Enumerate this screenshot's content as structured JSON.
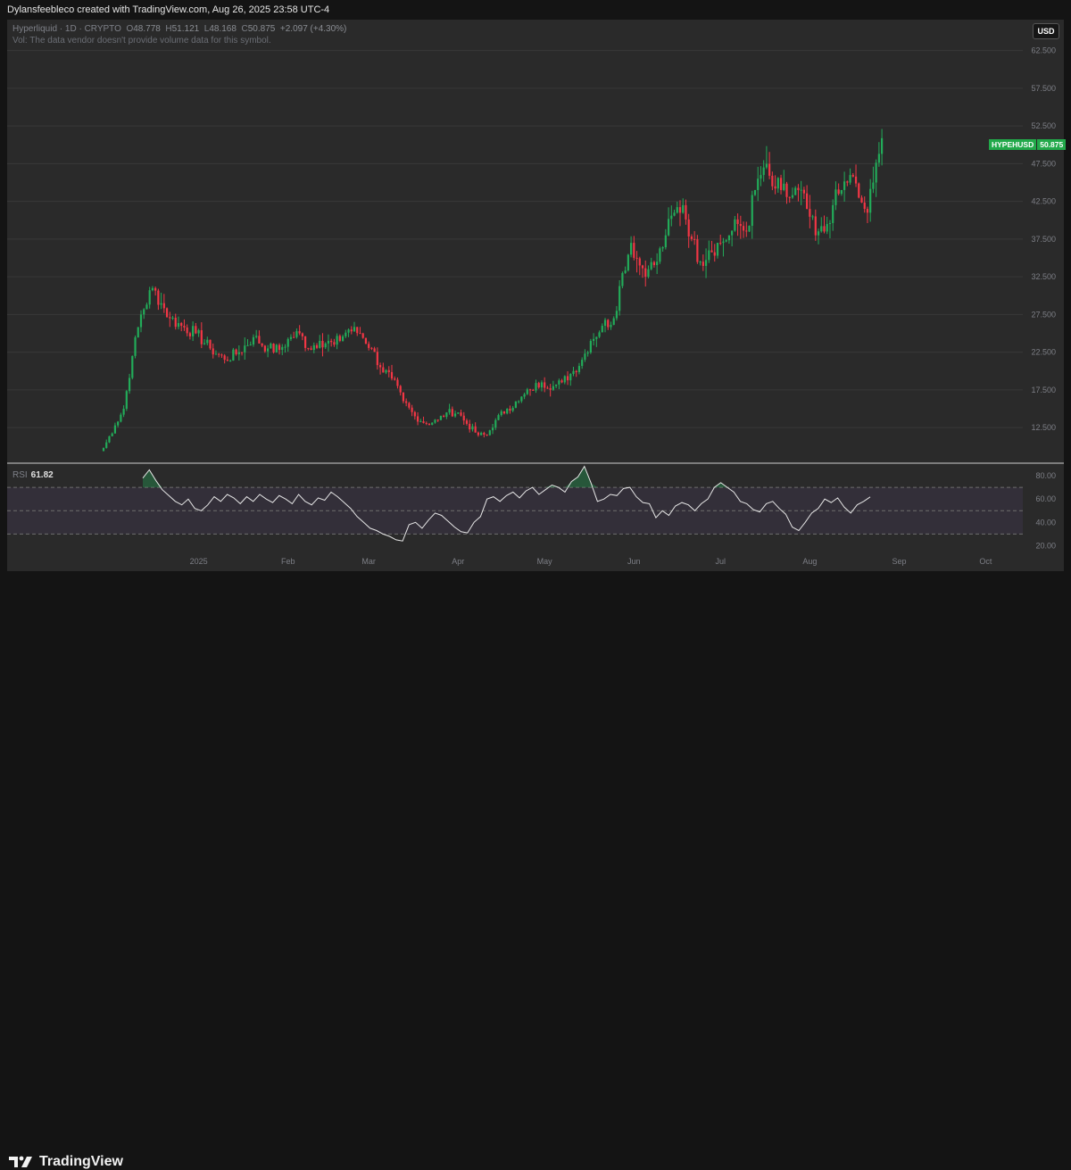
{
  "header": {
    "credit": "Dylansfeebleco created with TradingView.com, Aug 26, 2025 23:58 UTC-4"
  },
  "symbol_info": {
    "name": "Hyperliquid · 1D · CRYPTO",
    "open_label": "O",
    "open": "48.778",
    "high_label": "H",
    "high": "51.121",
    "low_label": "L",
    "low": "48.168",
    "close_label": "C",
    "close": "50.875",
    "change": "+2.097 (+4.30%)",
    "vol_note": "Vol: The data vendor doesn't provide volume data for this symbol."
  },
  "currency_button": "USD",
  "ticker": {
    "symbol": "HYPEHUSD",
    "price": "50.875"
  },
  "rsi": {
    "label": "RSI",
    "value": "61.82"
  },
  "footer": {
    "brand": "TradingView"
  },
  "colors": {
    "up": "#22ab59",
    "down": "#f23645",
    "background": "#2a2a2a",
    "rsi_line": "#e6e6e6",
    "rsi_band": "#3a3346"
  },
  "chart_data": [
    {
      "type": "candlestick",
      "title": "Hyperliquid · 1D · CRYPTO",
      "y_axis_ticks": [
        "62.500",
        "57.500",
        "52.500",
        "47.500",
        "42.500",
        "37.500",
        "32.500",
        "27.500",
        "22.500",
        "17.500",
        "12.500"
      ],
      "x_axis_ticks": [
        "2025",
        "Feb",
        "Mar",
        "Apr",
        "May",
        "Jun",
        "Jul",
        "Aug",
        "Sep",
        "Oct"
      ],
      "ylim": [
        7.9,
        66.6
      ],
      "x_start": "2024-11-29",
      "close_series": [
        {
          "date": "2024-11-29",
          "close": 9.8
        },
        {
          "date": "2024-12-03",
          "close": 12.8
        },
        {
          "date": "2024-12-06",
          "close": 15.0
        },
        {
          "date": "2024-12-09",
          "close": 22.0
        },
        {
          "date": "2024-12-12",
          "close": 27.5
        },
        {
          "date": "2024-12-16",
          "close": 31.0
        },
        {
          "date": "2024-12-19",
          "close": 29.0
        },
        {
          "date": "2024-12-22",
          "close": 27.0
        },
        {
          "date": "2024-12-26",
          "close": 26.0
        },
        {
          "date": "2024-12-31",
          "close": 25.0
        },
        {
          "date": "2025-01-05",
          "close": 23.0
        },
        {
          "date": "2025-01-10",
          "close": 21.5
        },
        {
          "date": "2025-01-15",
          "close": 22.5
        },
        {
          "date": "2025-01-20",
          "close": 24.5
        },
        {
          "date": "2025-01-25",
          "close": 23.0
        },
        {
          "date": "2025-01-29",
          "close": 22.8
        },
        {
          "date": "2025-02-02",
          "close": 24.5
        },
        {
          "date": "2025-02-05",
          "close": 25.0
        },
        {
          "date": "2025-02-08",
          "close": 23.0
        },
        {
          "date": "2025-02-12",
          "close": 24.0
        },
        {
          "date": "2025-02-17",
          "close": 23.5
        },
        {
          "date": "2025-02-22",
          "close": 25.5
        },
        {
          "date": "2025-02-26",
          "close": 25.0
        },
        {
          "date": "2025-03-02",
          "close": 23.0
        },
        {
          "date": "2025-03-05",
          "close": 20.5
        },
        {
          "date": "2025-03-09",
          "close": 19.0
        },
        {
          "date": "2025-03-13",
          "close": 16.0
        },
        {
          "date": "2025-03-17",
          "close": 14.0
        },
        {
          "date": "2025-03-21",
          "close": 13.0
        },
        {
          "date": "2025-03-25",
          "close": 13.5
        },
        {
          "date": "2025-03-28",
          "close": 14.5
        },
        {
          "date": "2025-04-01",
          "close": 14.5
        },
        {
          "date": "2025-04-04",
          "close": 13.0
        },
        {
          "date": "2025-04-08",
          "close": 11.5
        },
        {
          "date": "2025-04-11",
          "close": 11.5
        },
        {
          "date": "2025-04-14",
          "close": 13.5
        },
        {
          "date": "2025-04-18",
          "close": 15.0
        },
        {
          "date": "2025-04-22",
          "close": 16.0
        },
        {
          "date": "2025-04-26",
          "close": 17.5
        },
        {
          "date": "2025-04-30",
          "close": 18.5
        },
        {
          "date": "2025-05-04",
          "close": 18.0
        },
        {
          "date": "2025-05-07",
          "close": 18.5
        },
        {
          "date": "2025-05-11",
          "close": 20.0
        },
        {
          "date": "2025-05-14",
          "close": 21.5
        },
        {
          "date": "2025-05-17",
          "close": 24.0
        },
        {
          "date": "2025-05-21",
          "close": 26.0
        },
        {
          "date": "2025-05-25",
          "close": 27.0
        },
        {
          "date": "2025-05-28",
          "close": 33.0
        },
        {
          "date": "2025-05-31",
          "close": 37.0
        },
        {
          "date": "2025-06-03",
          "close": 34.0
        },
        {
          "date": "2025-06-06",
          "close": 33.5
        },
        {
          "date": "2025-06-09",
          "close": 34.5
        },
        {
          "date": "2025-06-12",
          "close": 38.0
        },
        {
          "date": "2025-06-15",
          "close": 41.0
        },
        {
          "date": "2025-06-18",
          "close": 42.0
        },
        {
          "date": "2025-06-21",
          "close": 37.5
        },
        {
          "date": "2025-06-24",
          "close": 34.5
        },
        {
          "date": "2025-06-27",
          "close": 36.0
        },
        {
          "date": "2025-07-01",
          "close": 37.0
        },
        {
          "date": "2025-07-04",
          "close": 38.0
        },
        {
          "date": "2025-07-07",
          "close": 39.5
        },
        {
          "date": "2025-07-10",
          "close": 38.5
        },
        {
          "date": "2025-07-13",
          "close": 44.0
        },
        {
          "date": "2025-07-16",
          "close": 47.0
        },
        {
          "date": "2025-07-19",
          "close": 44.5
        },
        {
          "date": "2025-07-22",
          "close": 44.0
        },
        {
          "date": "2025-07-25",
          "close": 43.0
        },
        {
          "date": "2025-07-28",
          "close": 44.0
        },
        {
          "date": "2025-07-31",
          "close": 41.5
        },
        {
          "date": "2025-08-03",
          "close": 38.0
        },
        {
          "date": "2025-08-06",
          "close": 38.5
        },
        {
          "date": "2025-08-09",
          "close": 42.0
        },
        {
          "date": "2025-08-12",
          "close": 44.0
        },
        {
          "date": "2025-08-15",
          "close": 46.0
        },
        {
          "date": "2025-08-18",
          "close": 43.0
        },
        {
          "date": "2025-08-21",
          "close": 41.0
        },
        {
          "date": "2025-08-23",
          "close": 45.0
        },
        {
          "date": "2025-08-25",
          "close": 48.8
        },
        {
          "date": "2025-08-26",
          "close": 50.875
        }
      ]
    },
    {
      "type": "line",
      "title": "RSI",
      "y_axis_ticks": [
        "80.00",
        "60.00",
        "40.00",
        "20.00"
      ],
      "ylim": [
        15,
        90
      ],
      "bands": {
        "upper": 70,
        "middle": 50,
        "lower": 30
      },
      "series": [
        {
          "values": [
            78,
            85,
            76,
            68,
            63,
            58,
            55,
            60,
            52,
            50,
            55,
            62,
            58,
            64,
            61,
            56,
            62,
            58,
            64,
            60,
            57,
            63,
            60,
            56,
            64,
            58,
            55,
            61,
            59,
            66,
            62,
            57,
            52,
            45,
            40,
            35,
            33,
            30,
            28,
            25,
            24,
            38,
            40,
            35,
            42,
            48,
            46,
            41,
            36,
            32,
            31,
            40,
            45,
            60,
            62,
            58,
            63,
            66,
            61,
            67,
            70,
            64,
            68,
            72,
            70,
            66,
            75,
            79,
            88,
            74,
            58,
            60,
            64,
            63,
            69,
            70,
            62,
            57,
            56,
            44,
            50,
            46,
            54,
            57,
            55,
            50,
            56,
            60,
            70,
            74,
            70,
            66,
            58,
            56,
            51,
            49,
            56,
            58,
            52,
            47,
            36,
            33,
            40,
            48,
            52,
            60,
            57,
            61,
            53,
            48,
            55,
            58,
            61.82
          ]
        }
      ]
    }
  ]
}
